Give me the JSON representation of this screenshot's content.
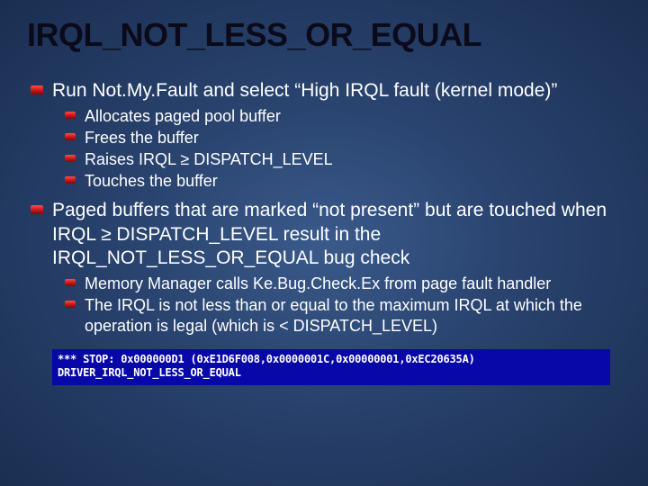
{
  "title": "IRQL_NOT_LESS_OR_EQUAL",
  "bullets": [
    {
      "text": "Run Not.My.Fault and select “High IRQL fault (kernel mode)”",
      "sub": [
        "Allocates paged pool buffer",
        "Frees the buffer",
        "Raises IRQL ≥ DISPATCH_LEVEL",
        "Touches the buffer"
      ]
    },
    {
      "text": "Paged buffers that are marked “not present” but are touched when IRQL ≥ DISPATCH_LEVEL result in the IRQL_NOT_LESS_OR_EQUAL bug check",
      "sub": [
        "Memory Manager calls Ke.Bug.Check.Ex from page fault handler",
        "The IRQL is not less than or equal to the maximum IRQL at which the operation is legal (which is < DISPATCH_LEVEL)"
      ]
    }
  ],
  "bsod": {
    "line1": "*** STOP: 0x000000D1 (0xE1D6F008,0x0000001C,0x00000001,0xEC20635A)",
    "line2": "DRIVER_IRQL_NOT_LESS_OR_EQUAL"
  }
}
